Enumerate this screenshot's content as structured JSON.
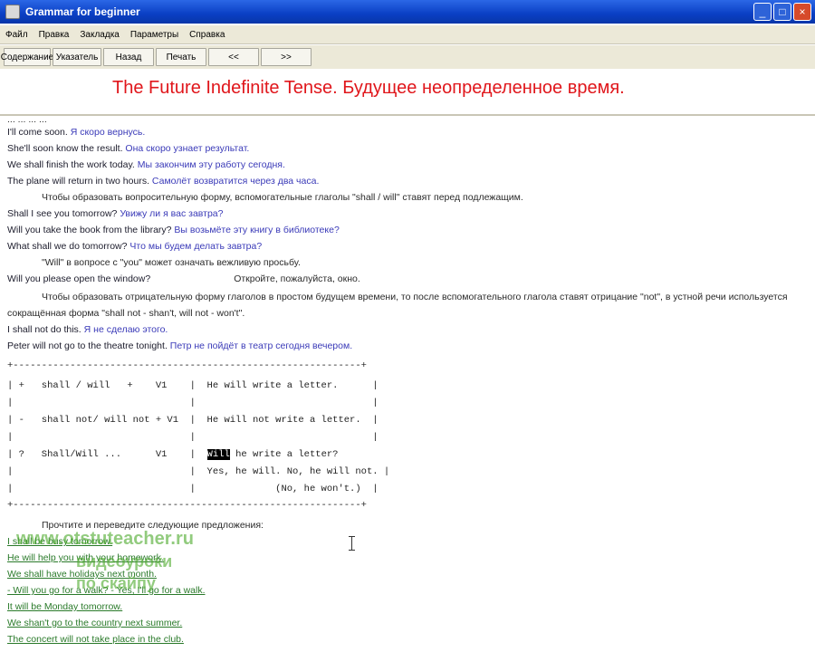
{
  "window": {
    "title": "Grammar for beginner",
    "buttons": [
      "minimize",
      "maximize",
      "close"
    ]
  },
  "menu": [
    "Файл",
    "Правка",
    "Закладка",
    "Параметры",
    "Справка"
  ],
  "toolbar": [
    "Содержание",
    "Указатель",
    "Назад",
    "Печать",
    "<<",
    ">>"
  ],
  "banner": {
    "title": "The Future Indefinite Tense. Будущее неопределенное время."
  },
  "content": {
    "top_partial": "... ... ... ...",
    "sentences": [
      {
        "en": "I'll come soon.",
        "ru": "Я скоро вернусь."
      },
      {
        "en": "She'll soon know the result.",
        "ru": "Она скоро узнает результат."
      },
      {
        "en": "We shall finish the work today.",
        "ru": "Мы закончим эту работу сегодня."
      },
      {
        "en": "The plane will return in two hours.",
        "ru": "Самолёт возвратится через два часа."
      }
    ],
    "rule_question": "Чтобы образовать  вопросительную  форму,  вспомогательные  глаголы  \"shall / will\"  ставят перед подлежащим.",
    "questions": [
      {
        "en": "Shall I see you tomorrow?",
        "ru": "Увижу ли я вас завтра?"
      },
      {
        "en": "Will you take the book from the library?",
        "ru": "Вы возьмёте эту книгу в библиотеке?"
      },
      {
        "en": "What shall we do tomorrow?",
        "ru": "Что мы будем делать завтра?"
      }
    ],
    "rule_request": "\"Will\" в вопросе с \"you\" может означать вежливую просьбу.",
    "request": {
      "en": "Will you please open the window?",
      "ru": "Откройте, пожалуйста, окно."
    },
    "rule_negative_1": "Чтобы образовать отрицательную форму глаголов в простом будущем времени, то после вспомогательного глагола ставят отрицание \"not\", в устной речи используется",
    "rule_negative_2": "сокращённая форма \"shall not - shan't, will not - won't\".",
    "negatives": [
      {
        "en": "I shall not do this.",
        "ru": "Я не сделаю этого."
      },
      {
        "en": "Peter will not go to the theatre tonight.",
        "ru": "Петр не пойдёт в театр сегодня вечером."
      }
    ],
    "table_lines": [
      "+-------------------------------------------------------------+",
      "| +   shall / will   +    V1    |  He will write a letter.      |",
      "|                               |                               |",
      "| -   shall not/ will not + V1  |  He will not write a letter.  |",
      "|                               |                               |",
      "| ?   Shall/Will ...      V1    |  ",
      "|                               |  Yes, he will. No, he will not. |",
      "|                               |              (No, he won't.)  |",
      "+-------------------------------------------------------------+"
    ],
    "table_q_word": "Will",
    "table_q_rest": " he write a letter?",
    "exercise_prompt": "Прочтите и переведите следующие предложения:",
    "exercises": [
      "I shall be busy tomorrow.",
      "He will help you with your homework.",
      "We shall have holidays next month.",
      "- Will you go for a walk? - Yes, I'll go for a walk.",
      "It will be Monday tomorrow.",
      "We shan't go to the country next summer.",
      "The concert will not take place in the club."
    ]
  },
  "watermark": {
    "line1": "www.otstuteacher.ru",
    "line2": "видеоуроки",
    "line3": "по скайпу"
  }
}
